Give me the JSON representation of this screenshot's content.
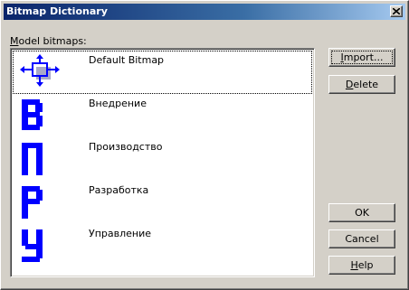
{
  "window": {
    "title": "Bitmap Dictionary"
  },
  "list": {
    "label_prefix": "M",
    "label_rest": "odel bitmaps:",
    "items": [
      {
        "name": "Default Bitmap",
        "icon": "default-bitmap-icon"
      },
      {
        "name": "Внедрение",
        "icon": "cyrillic-v-letter-icon"
      },
      {
        "name": "Производство",
        "icon": "cyrillic-p-letter-icon"
      },
      {
        "name": "Разработка",
        "icon": "cyrillic-r-letter-icon"
      },
      {
        "name": "Управление",
        "icon": "cyrillic-u-letter-icon"
      }
    ]
  },
  "buttons": {
    "import": {
      "mnemonic": "I",
      "rest": "mport..."
    },
    "delete": {
      "mnemonic": "D",
      "rest": "elete"
    },
    "ok": {
      "label": "OK"
    },
    "cancel": {
      "label": "Cancel"
    },
    "help": {
      "mnemonic": "H",
      "rest": "elp"
    }
  },
  "colors": {
    "letter_blue": "#0000ff",
    "title_bar": "#0a246a"
  }
}
